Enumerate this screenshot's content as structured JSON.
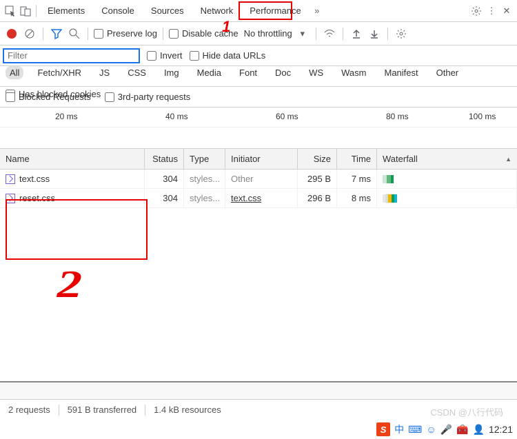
{
  "mainTabs": [
    "Elements",
    "Console",
    "Sources",
    "Network",
    "Performance"
  ],
  "activeTab": "Network",
  "row2": {
    "preserveLog": "Preserve log",
    "disableCache": "Disable cache",
    "throttling": "No throttling"
  },
  "row3": {
    "filterPlaceholder": "Filter",
    "invert": "Invert",
    "hideDataUrls": "Hide data URLs"
  },
  "filterTypes": [
    "All",
    "Fetch/XHR",
    "JS",
    "CSS",
    "Img",
    "Media",
    "Font",
    "Doc",
    "WS",
    "Wasm",
    "Manifest",
    "Other"
  ],
  "hasBlockedCookies": "Has blocked cookies",
  "row5": {
    "blockedRequests": "Blocked Requests",
    "thirdParty": "3rd-party requests"
  },
  "timeline": [
    "20 ms",
    "40 ms",
    "60 ms",
    "80 ms",
    "100 ms"
  ],
  "columns": {
    "name": "Name",
    "status": "Status",
    "type": "Type",
    "initiator": "Initiator",
    "size": "Size",
    "time": "Time",
    "waterfall": "Waterfall"
  },
  "rows": [
    {
      "name": "text.css",
      "status": "304",
      "type": "styles...",
      "initiator": "Other",
      "initiatorLink": false,
      "size": "295 B",
      "time": "7 ms",
      "wf": [
        [
          "#cde3d5",
          6
        ],
        [
          "#5fb979",
          6
        ],
        [
          "#0f9d58",
          4
        ]
      ]
    },
    {
      "name": "reset.css",
      "status": "304",
      "type": "styles...",
      "initiator": "text.css",
      "initiatorLink": true,
      "size": "296 B",
      "time": "8 ms",
      "wf": [
        [
          "#e8e8e8",
          4
        ],
        [
          "#cde3d5",
          4
        ],
        [
          "#f4b400",
          5
        ],
        [
          "#0f9d58",
          4
        ],
        [
          "#12b5cb",
          4
        ]
      ]
    }
  ],
  "status": {
    "requests": "2 requests",
    "transferred": "591 B transferred",
    "resources": "1.4 kB resources"
  },
  "clock": "12:21",
  "watermark": "CSDN @八行代码",
  "ime": "中"
}
